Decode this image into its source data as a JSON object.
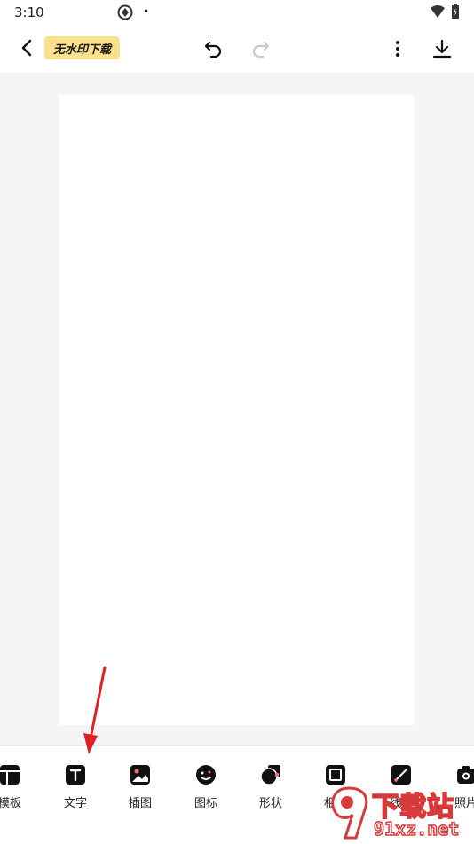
{
  "status_bar": {
    "time": "3:10",
    "dot": "•"
  },
  "top_bar": {
    "badge_label": "无水印下载"
  },
  "toolbar": {
    "items": [
      {
        "label": "模板",
        "icon": "template-icon"
      },
      {
        "label": "文字",
        "icon": "text-icon"
      },
      {
        "label": "插图",
        "icon": "illustration-icon"
      },
      {
        "label": "图标",
        "icon": "sticker-icon"
      },
      {
        "label": "形状",
        "icon": "shape-icon"
      },
      {
        "label": "相框",
        "icon": "frame-icon"
      },
      {
        "label": "线条",
        "icon": "line-icon"
      },
      {
        "label": "照片",
        "icon": "photo-icon"
      }
    ]
  },
  "watermark": {
    "text_big": "下载站",
    "text_small": "91xz.net"
  },
  "colors": {
    "badge_bg": "#fbe08d",
    "accent_red": "#d63a3a",
    "canvas_bg": "#f5f5f5"
  }
}
